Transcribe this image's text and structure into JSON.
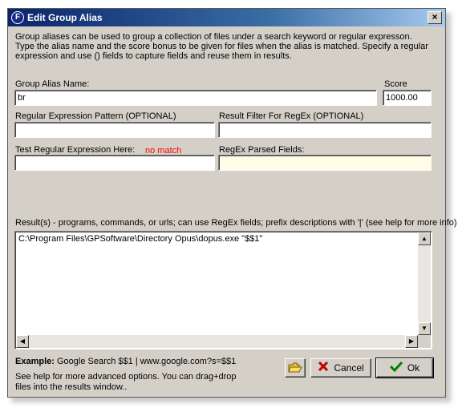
{
  "window": {
    "title": "Edit Group Alias",
    "app_icon_letter": "F",
    "close_glyph": "×"
  },
  "description": {
    "line1": "Group aliases can be used to group a collection of files under a search keyword or regular expresson.",
    "line2": "Type the alias name and the score bonus to be given for files when the alias is matched.  Specify a regular expression and use () fields to capture fields and reuse them in results."
  },
  "fields": {
    "alias_name": {
      "label": "Group Alias Name:",
      "value": "br"
    },
    "score": {
      "label": "Score",
      "value": "1000.00"
    },
    "regex_pattern": {
      "label": "Regular Expression Pattern (OPTIONAL)",
      "value": ""
    },
    "result_filter": {
      "label": "Result Filter For RegEx (OPTIONAL)",
      "value": ""
    },
    "test_regex": {
      "label": "Test Regular Expression Here:",
      "value": "",
      "status": "no match"
    },
    "parsed_fields": {
      "label": "RegEx Parsed Fields:",
      "value": ""
    }
  },
  "results": {
    "label": "Result(s) - programs, commands, or urls; can use RegEx fields; prefix descriptions with '|' (see help for more info)",
    "value": "C:\\Program Files\\GPSoftware\\Directory Opus\\dopus.exe \"$$1\""
  },
  "example": {
    "label": "Example:",
    "text": "Google Search $$1 | www.google.com?s=$$1"
  },
  "help": {
    "line1": "See help for more advanced options.  You can drag+drop",
    "line2": "files into the results window.."
  },
  "buttons": {
    "cancel_label": "Cancel",
    "ok_label": "Ok"
  },
  "colors": {
    "titlebar": "#0a246a",
    "status_red": "#ff0000",
    "parsed_bg": "#fffde6",
    "face": "#d4d0c8"
  }
}
